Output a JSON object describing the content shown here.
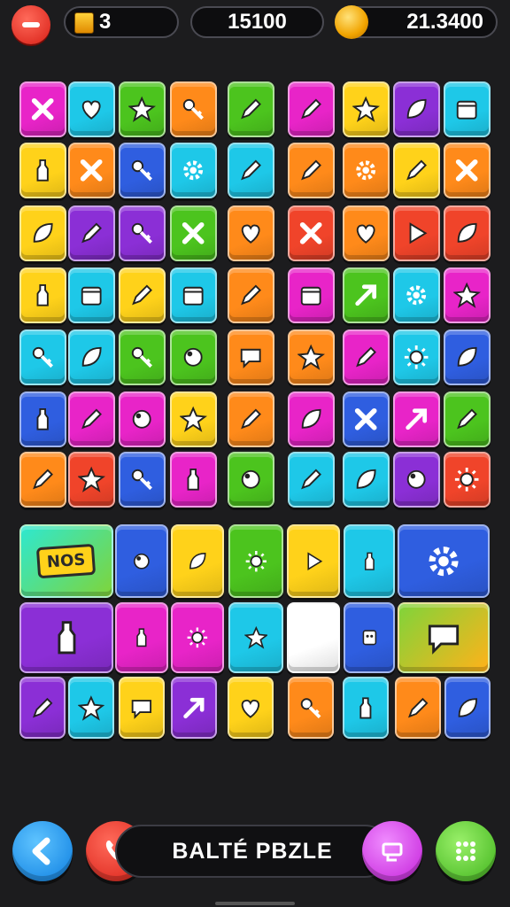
{
  "header": {
    "lives_value": "3",
    "score_value": "15100",
    "coins_value": "21.3400"
  },
  "footer": {
    "title": "BALTÉ PBZLE"
  },
  "colors": {
    "purple": "#8b2fd6",
    "cyan": "#1ec8e8",
    "green": "#4cc41e",
    "yellow": "#ffd21a",
    "orange": "#ff8a1a",
    "red": "#f0442a",
    "magenta": "#e824c8",
    "blue": "#2f5ee0",
    "lime": "#7fd43a"
  },
  "tiles": {
    "icon_grid_rows": 7,
    "icon_grid_columns": 9,
    "row8_badge": "NOS",
    "row8_icons": [
      "purple-orb-icon",
      "blue-leaf-icon",
      "orange-sun-icon",
      "play-arrow-icon",
      "green-bottle-icon",
      "gear-icon"
    ],
    "row9_icons": [
      "orange-bottle-icon",
      "green-pot-icon",
      "sun-icon",
      "star-icon",
      "red-gear-icon",
      "face-icon",
      "speech-bubble-icon"
    ],
    "row10_icons": [
      "pencil-icon",
      "star-icon",
      "speech-bubble-icon",
      "arrow-icon",
      "heart-icon",
      "wrench-icon",
      "bottle-icon",
      "pencil-icon",
      "ice-cream-icon"
    ]
  }
}
